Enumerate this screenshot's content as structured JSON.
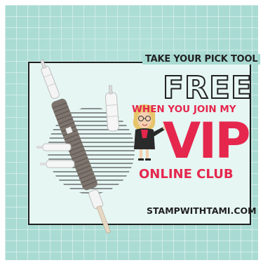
{
  "promo": {
    "headline": "TAKE YOUR PICK TOOL",
    "free": "FREE",
    "when": "WHEN YOU JOIN MY",
    "vip": "VIP",
    "club": "ONLINE CLUB",
    "website": "STAMPWITHTAMI.COM"
  },
  "icons": {
    "tool": "pick-tool-icon",
    "character": "cartoon-woman-icon"
  },
  "colors": {
    "background": "#a9dbd3",
    "accent": "#e5274d",
    "text": "#1f1f1f"
  }
}
